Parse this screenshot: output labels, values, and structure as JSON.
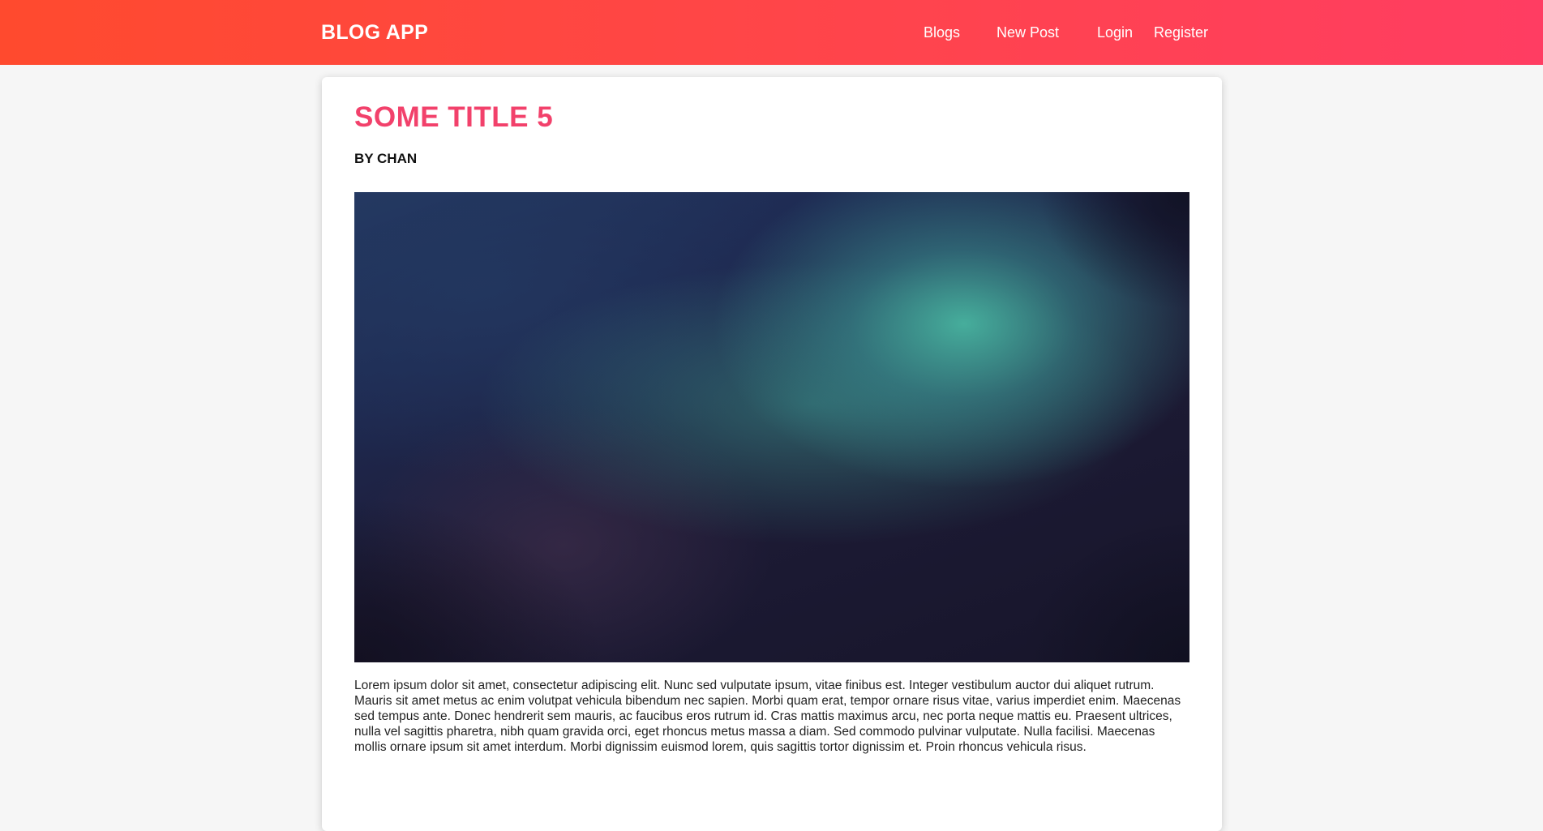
{
  "navbar": {
    "brand": "BLOG APP",
    "links": {
      "blogs": "Blogs",
      "new_post": "New Post",
      "login": "Login",
      "register": "Register"
    },
    "gradient_start": "#ff4a2e",
    "gradient_end": "#ff3d62"
  },
  "post": {
    "title": "SOME TITLE 5",
    "author": "BY CHAN",
    "title_color": "#f2416b",
    "body": "Lorem ipsum dolor sit amet, consectetur adipiscing elit. Nunc sed vulputate ipsum, vitae finibus est. Integer vestibulum auctor dui aliquet rutrum. Mauris sit amet metus ac enim volutpat vehicula bibendum nec sapien. Morbi quam erat, tempor ornare risus vitae, varius imperdiet enim. Maecenas sed tempus ante. Donec hendrerit sem mauris, ac faucibus eros rutrum id. Cras mattis maximus arcu, nec porta neque mattis eu. Praesent ultrices, nulla vel sagittis pharetra, nibh quam gravida orci, eget rhoncus metus massa a diam. Sed commodo pulvinar vulputate. Nulla facilisi. Maecenas mollis ornare ipsum sit amet interdum. Morbi dignissim euismod lorem, quis sagittis tortor dignissim et. Proin rhoncus vehicula risus."
  }
}
